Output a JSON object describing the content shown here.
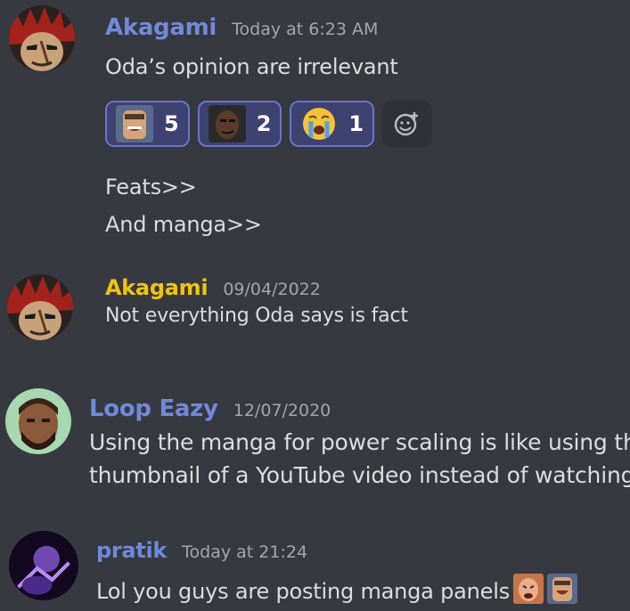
{
  "messages": [
    {
      "author": "Akagami",
      "author_color": "#7289da",
      "timestamp": "Today at 6:23 AM",
      "lines": [
        "Oda’s opinion are irrelevant"
      ],
      "reactions": [
        {
          "emoji": "laughing-man-emoji",
          "count": "5"
        },
        {
          "emoji": "smirking-man-emoji",
          "count": "2"
        },
        {
          "emoji": "crying-face-emoji",
          "count": "1"
        }
      ],
      "followups": [
        "Feats>>",
        "And manga>>"
      ]
    },
    {
      "author": "Akagami",
      "author_color": "#f1c40f",
      "timestamp": "09/04/2022",
      "lines": [
        "Not everything Oda says is fact"
      ]
    },
    {
      "author": "Loop Eazy",
      "author_color": "#7289da",
      "timestamp": "12/07/2020",
      "lines": [
        "Using the manga for power scaling is like using the",
        "thumbnail of a YouTube video instead of watching"
      ]
    },
    {
      "author": "pratik",
      "author_color": "#7289da",
      "timestamp": "Today at 21:24",
      "lines": [
        "Lol you guys are posting manga panels"
      ],
      "inline_emojis": [
        "crying-man-emoji",
        "laughing-man-emoji"
      ]
    }
  ],
  "colors": {
    "background": "#36393f",
    "reaction_bg": "#3d4270",
    "reaction_border": "#6a73c9"
  }
}
